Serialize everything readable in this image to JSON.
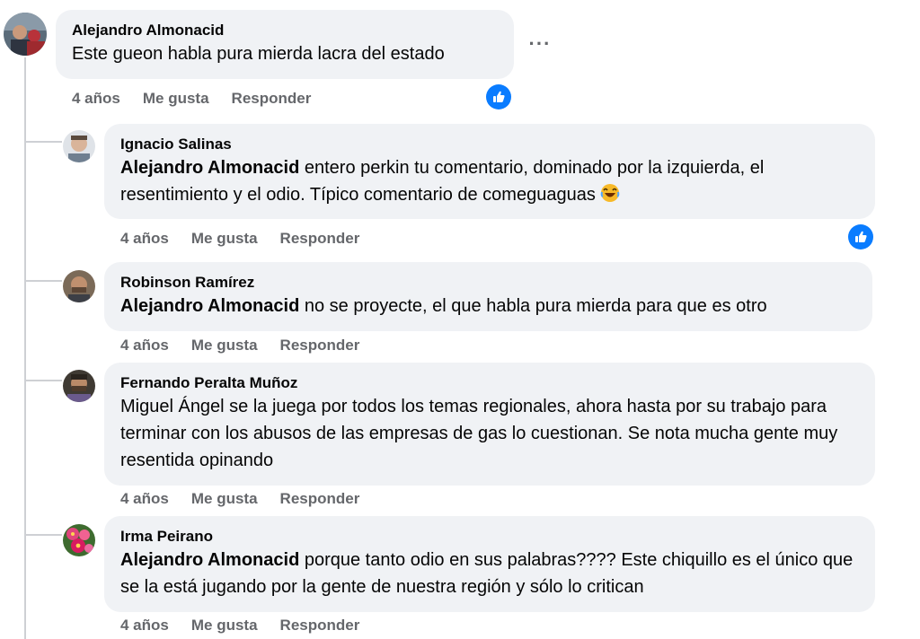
{
  "colors": {
    "bubble": "#f0f2f5",
    "secondary_text": "#65676b",
    "like_blue": "#0a7cff",
    "thread_line": "#ced0d4"
  },
  "comments": [
    {
      "author": "Alejandro Almonacid",
      "mention": "",
      "text": "Este gueon habla pura mierda lacra del estado",
      "time": "4 años",
      "like": "Me gusta",
      "reply": "Responder",
      "reaction": "like-icon",
      "avatar": "avatar-photo"
    },
    {
      "author": "Ignacio Salinas",
      "mention": "Alejandro Almonacid",
      "text": " entero perkin tu comentario, dominado por la izquierda, el resentimiento y el odio. Típico comentario de comeguaguas ",
      "emoji": "😂",
      "time": "4 años",
      "like": "Me gusta",
      "reply": "Responder",
      "reaction": "like-icon",
      "avatar": "avatar-photo"
    },
    {
      "author": "Robinson Ramírez",
      "mention": "Alejandro Almonacid",
      "text": " no se proyecte, el que habla pura mierda para que es otro",
      "time": "4 años",
      "like": "Me gusta",
      "reply": "Responder",
      "avatar": "avatar-photo"
    },
    {
      "author": "Fernando Peralta Muñoz",
      "mention": "",
      "text": "Miguel Ángel se la juega por todos los temas regionales, ahora hasta por su trabajo para terminar con los abusos de las empresas de gas lo cuestionan. Se nota mucha gente muy resentida opinando",
      "time": "4 años",
      "like": "Me gusta",
      "reply": "Responder",
      "avatar": "avatar-photo"
    },
    {
      "author": "Irma Peirano",
      "mention": "Alejandro Almonacid",
      "text": " porque tanto odio en sus palabras???? Este chiquillo es el único que se la está jugando por la gente de nuestra región y sólo lo critican",
      "time": "4 años",
      "like": "Me gusta",
      "reply": "Responder",
      "avatar": "avatar-flowers"
    }
  ],
  "more_button_icon": "more-options-icon"
}
